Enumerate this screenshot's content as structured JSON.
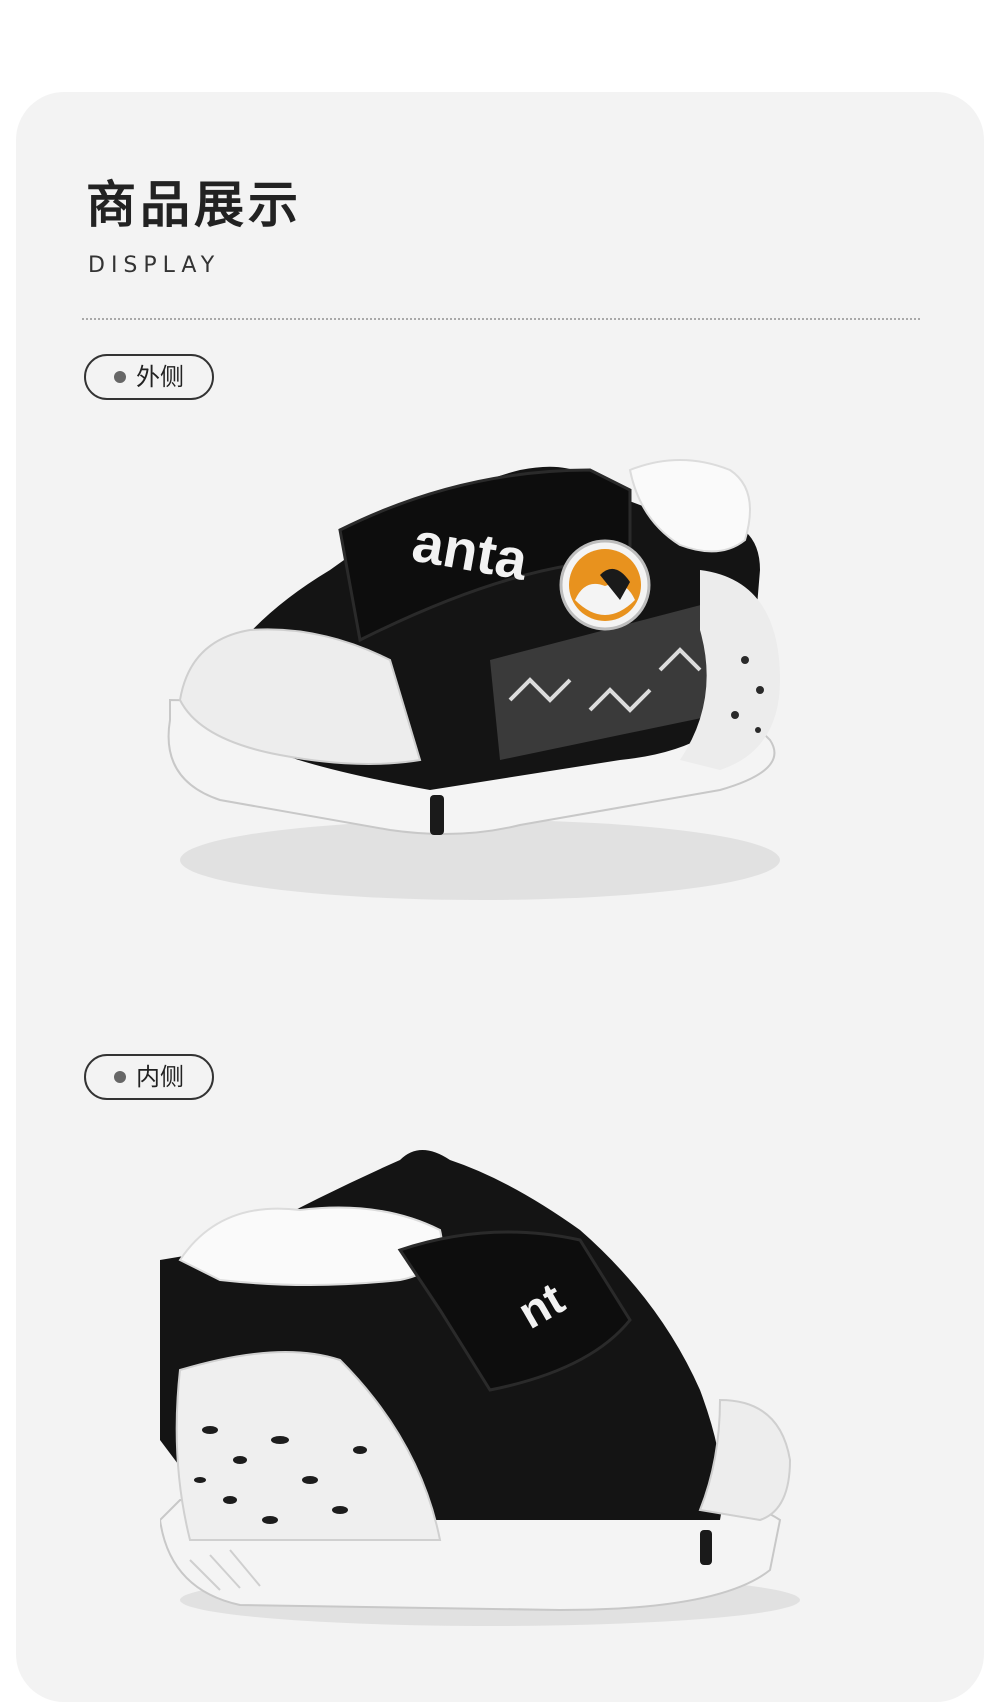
{
  "section": {
    "title": "商品展示",
    "subtitle": "DISPLAY"
  },
  "views": [
    {
      "label": "外侧",
      "brand_text": "anta"
    },
    {
      "label": "内侧",
      "brand_text": "nt"
    }
  ],
  "colors": {
    "card_bg": "#f3f3f3",
    "shoe_black": "#141414",
    "sole_white": "#f4f4f4",
    "badge_orange": "#e8921e"
  }
}
